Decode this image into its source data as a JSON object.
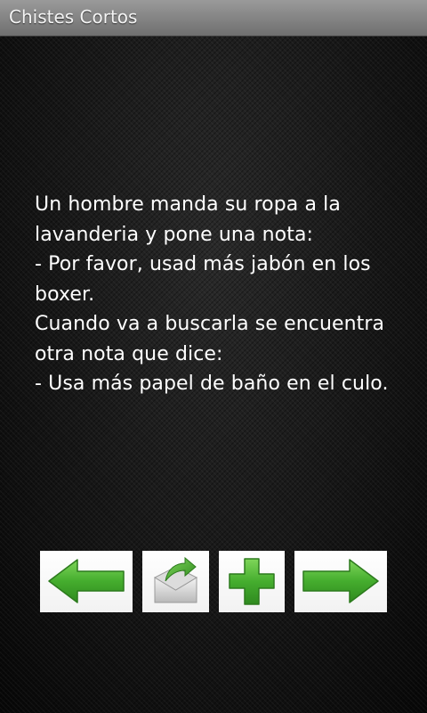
{
  "app": {
    "title": "Chistes Cortos"
  },
  "joke": {
    "text": "Un hombre manda su ropa a la lavanderia y pone una nota:\n- Por favor, usad más jabón en los boxer.\nCuando va a buscarla se encuentra otra nota que dice:\n- Usa más papel de baño en el culo."
  },
  "toolbar": {
    "buttons": [
      {
        "icon": "arrow-left-icon"
      },
      {
        "icon": "share-envelope-icon"
      },
      {
        "icon": "plus-icon"
      },
      {
        "icon": "arrow-right-icon"
      }
    ]
  },
  "colors": {
    "accent_green": "#3fa82e",
    "titlebar": "#8a8a8a",
    "background": "#111111",
    "text": "#ffffff"
  }
}
